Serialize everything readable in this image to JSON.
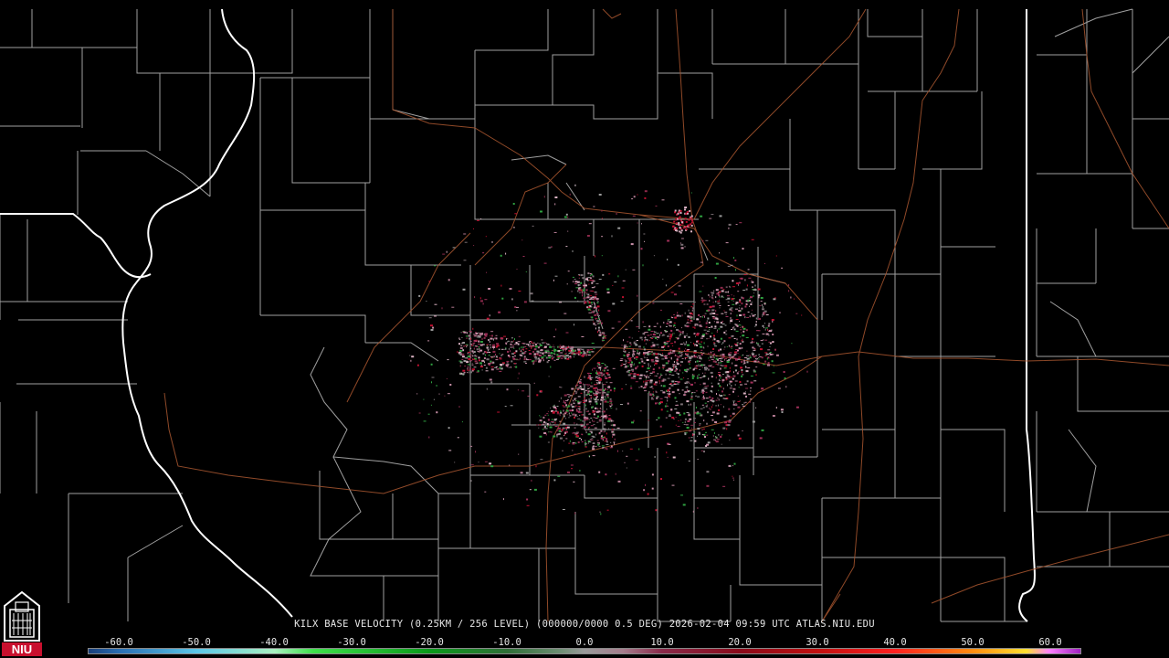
{
  "title": "KILX BASE VELOCITY (0.25KM / 256 LEVEL) (000000/0000 0.5 DEG) 2026-02-04 09:59 UTC  ATLAS.NIU.EDU",
  "logo_text": "NIU",
  "colors": {
    "background": "#000000",
    "county_lines": "#bdbdbd",
    "state_lines": "#ffffff",
    "roads": "#a0522d",
    "logo_red": "#c8102e"
  },
  "icons": [
    "niu-logo-icon"
  ],
  "scale": {
    "labels": [
      "-60.0",
      "-50.0",
      "-40.0",
      "-30.0",
      "-20.0",
      "-10.0",
      "0.0",
      "10.0",
      "20.0",
      "30.0",
      "40.0",
      "50.0",
      "60.0"
    ],
    "stops": [
      {
        "value": -64,
        "color": "#1a3f7a"
      },
      {
        "value": -60,
        "color": "#2a6fb3"
      },
      {
        "value": -50,
        "color": "#5cc7e8"
      },
      {
        "value": -40,
        "color": "#a8f0c0"
      },
      {
        "value": -35,
        "color": "#3ee04a"
      },
      {
        "value": -20,
        "color": "#0a9a1a"
      },
      {
        "value": -10,
        "color": "#2f6f37"
      },
      {
        "value": -3,
        "color": "#6f8f74"
      },
      {
        "value": 0,
        "color": "#9a9a9a"
      },
      {
        "value": 5,
        "color": "#a67c8c"
      },
      {
        "value": 10,
        "color": "#8a2a4a"
      },
      {
        "value": 20,
        "color": "#8a0a1a"
      },
      {
        "value": 30,
        "color": "#c01010"
      },
      {
        "value": 40,
        "color": "#ff2020"
      },
      {
        "value": 50,
        "color": "#ff8c10"
      },
      {
        "value": 57,
        "color": "#ffe030"
      },
      {
        "value": 60,
        "color": "#ff80ff"
      },
      {
        "value": 64,
        "color": "#a020c0"
      }
    ],
    "range": [
      -64,
      64
    ]
  }
}
